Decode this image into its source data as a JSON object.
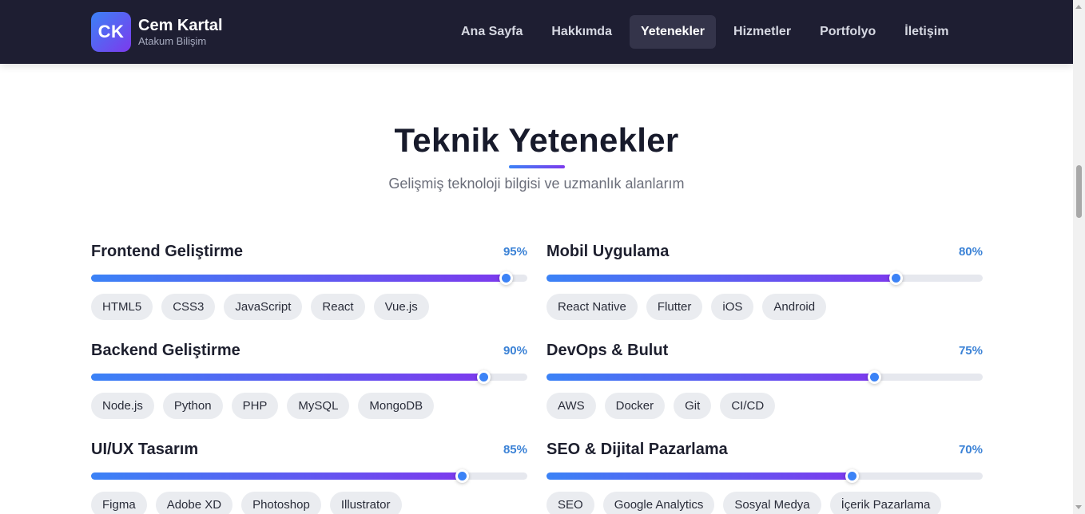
{
  "header": {
    "logo_text": "CK",
    "brand_name": "Cem Kartal",
    "brand_subtitle": "Atakum Bilişim",
    "nav": [
      {
        "label": "Ana Sayfa",
        "active": false
      },
      {
        "label": "Hakkımda",
        "active": false
      },
      {
        "label": "Yetenekler",
        "active": true
      },
      {
        "label": "Hizmetler",
        "active": false
      },
      {
        "label": "Portfolyo",
        "active": false
      },
      {
        "label": "İletişim",
        "active": false
      }
    ]
  },
  "section": {
    "title": "Teknik Yetenekler",
    "subtitle": "Gelişmiş teknoloji bilgisi ve uzmanlık alanlarım"
  },
  "skills": [
    {
      "name": "Frontend Geliştirme",
      "percent_label": "95%",
      "level": 0.95,
      "tags": [
        "HTML5",
        "CSS3",
        "JavaScript",
        "React",
        "Vue.js"
      ]
    },
    {
      "name": "Mobil Uygulama",
      "percent_label": "80%",
      "level": 0.8,
      "tags": [
        "React Native",
        "Flutter",
        "iOS",
        "Android"
      ]
    },
    {
      "name": "Backend Geliştirme",
      "percent_label": "90%",
      "level": 0.9,
      "tags": [
        "Node.js",
        "Python",
        "PHP",
        "MySQL",
        "MongoDB"
      ]
    },
    {
      "name": "DevOps & Bulut",
      "percent_label": "75%",
      "level": 0.75,
      "tags": [
        "AWS",
        "Docker",
        "Git",
        "CI/CD"
      ]
    },
    {
      "name": "UI/UX Tasarım",
      "percent_label": "85%",
      "level": 0.85,
      "tags": [
        "Figma",
        "Adobe XD",
        "Photoshop",
        "Illustrator"
      ]
    },
    {
      "name": "SEO & Dijital Pazarlama",
      "percent_label": "70%",
      "level": 0.7,
      "tags": [
        "SEO",
        "Google Analytics",
        "Sosyal Medya",
        "İçerik Pazarlama"
      ]
    }
  ],
  "colors": {
    "navbar_bg": "#1e1e32",
    "accent_start": "#3b82f6",
    "accent_end": "#7c3aed",
    "percent_text": "#3b82d6"
  }
}
